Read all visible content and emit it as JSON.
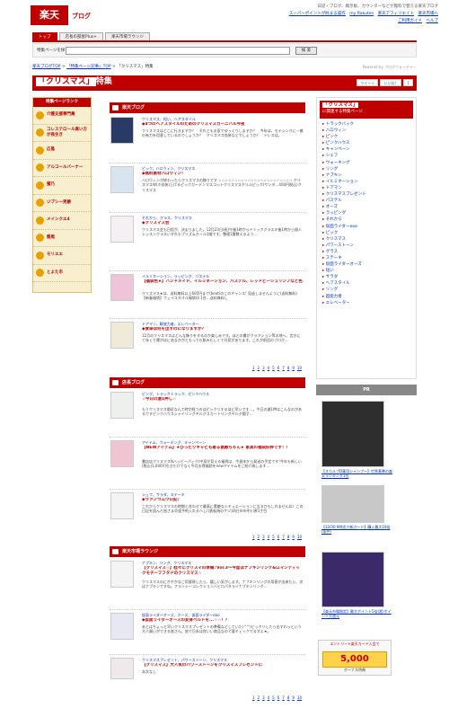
{
  "header": {
    "logo": "楽天",
    "logo_sub": "ブログ",
    "tagline": "日記・ブログ、掲示板、カウンターなどが無料で使える楽天ブログ",
    "links": [
      "スーパーポイントが貯まる操作",
      "my Rakuten",
      "楽天アフィリエイト",
      "楽天市場へ"
    ],
    "links2": [
      "ご利用ガイド",
      "ヘルプ"
    ]
  },
  "tabs": [
    "トップ",
    "店長の部屋Plus+",
    "楽天市場ラウンジ"
  ],
  "search": {
    "label": "特集ページを探す",
    "button": "検 索"
  },
  "breadcrumb": {
    "items": [
      "楽天ブログTOP",
      "「特集ページ記事」TOP",
      "「クリスマス」特集"
    ]
  },
  "powered": "Powered by ブログウォッチャー",
  "page_title": {
    "keyword": "「クリスマス」",
    "suffix": "特集"
  },
  "share": [
    "ツイート",
    "いいね！",
    "1"
  ],
  "left_nav": {
    "heading": "特集ページランク",
    "items": [
      "介護支援専門員",
      "コレステロール高い方が長生き",
      "広島",
      "アルコールバーナー",
      "蜜乃",
      "ジプシー男爵",
      "メインクエ4",
      "競馬",
      "モリエエ",
      "とよた市"
    ]
  },
  "sections": [
    {
      "heading": "楽天ブログ",
      "entries": [
        {
          "tags": "クリスマス、短い、ヘアスタイル",
          "title": "◆4つのヘアスタイルのためのクリスマスカーニバル今夜",
          "body": "クリスマスはどこに行きますか？　それともお家でゆっくりしますか？　今年は、モテシンクに一着の有力を用意しているのでしょうか？　クリスマス衣装などでしょうか？　ドレスは。"
        },
        {
          "tags": "ピック、ハロウィン、クリスマス",
          "title": "◆無料素材ハロウィン！",
          "body": "ハロウィンが終わったらクリスマスの飾りです ☆☆☆☆☆☆☆☆☆☆☆☆☆☆☆☆☆☆☆☆☆☆☆ クリスマスW(ホ衣装)上げるピックガーデンマスコットクリスマスクリルピック(サンタ…400円税込)クリスマス"
        },
        {
          "tags": "それから、グラス、クリスマス",
          "title": "◆クリスマス会",
          "body": "クリスマス会も日程が、決まりました。12月23日(祝)午後1時からドミックグラスキ後1時から個人レッスンクラスいずれもプリズムホール1階です。整理1番数えるよう..."
        },
        {
          "tags": "イルミネーション、ラッピング、パステル",
          "title": "【福袋色★】ハンドメイド、イルミネーション、パステル、レッドビーシュリンプなど色★！",
          "body": "クリスマス★は、送料無料以上600円まで(beat)のこのチャンス! 見逃しませんように(送料無料)【新春福袋】フェイスタオル福袋印 1台…送料無料し"
        },
        {
          "tags": "ドアマン、解放力者、エレベーター",
          "title": "◆食卓は何を出すのになりますか？",
          "body": "12月のクリスマスはどんな飾りをするのか楽しみです。ほとの書がクラクション等の地へ、言方にて年くて運がはにあなかがともっても飲みたしくて刊見があります。これが前回のブログ..."
        }
      ],
      "pager": [
        "1",
        "2",
        "3",
        "4",
        "5",
        "6",
        "7",
        "8",
        "9",
        "10"
      ]
    },
    {
      "heading": "店長ブログ",
      "entries": [
        {
          "tags": "ピング、トラックトラック、ピンクハウス",
          "title": "☆今日の激1押し☆",
          "body": "もうクリスマス間近なんて時が経つのはピックリするほど早いです…。今日の激1押はこんなのがあるですピンクハウスシャイリングギルグスカートリングギルグ帽子..."
        },
        {
          "tags": "アイテム、ウォーキング、キャンペーン",
          "title": "【NEWアイテム】★ぴったりキャビも寄る素敵ちゃん★ 家具の福袋好評です！！",
          "body": "書店店クリスマスNハッピーパック)中身が見える福袋は、今週末から発送の予定です!今年も新しい(税込)1,000円引きだけでなく今月お得福袋をnewアイテムをご紹介致します..."
        },
        {
          "tags": "シェフ、サラダ、ステーキ",
          "title": "◆ヴァンつムウ日記♪",
          "body": "これからクリスマスの時期と合わせて最高に素敵なシチュエーションになるかもしれませんね！この日記を読んだ皆さま早速予約入れるべし!(鉄板焼のケヅ)四日市市中川原1丁目"
        }
      ],
      "pager": [
        "1",
        "2",
        "3",
        "4",
        "5",
        "6",
        "7",
        "8",
        "9",
        "10"
      ]
    },
    {
      "heading": "楽天市場ラウンジ",
      "entries": [
        {
          "tags": "ナプキン、リング、クリスマス",
          "title": "【クリスマス☆】桂々にクリスマの準備♪Vol.3～今度はナプキンリング&ロマンティックモチーフフタドのクリスマス☆",
          "body": "クリスマスのにぎやかなご用意致したら、嬉しい気がします。ナプキンリングの用意が出来たら、次はナプキンですね。フランシーコレクションバヒロパタライナプキンリング..."
        },
        {
          "tags": "仮面ライダーオーズ、オーズ、仮面ライダーooo",
          "title": "◆仮面ライダーオーズの変身ベルトを...☆☆！？",
          "body": "あとはちょっと早いクリスマスプレゼントの準備などしていた(^^)ビックリしたら出すわっという大人買いができる皆さん。皆で日本は良いい商品なので要チェックでますよ★。"
        },
        {
          "tags": "クリスマスプレゼント、パワーストーン、クリスマス",
          "title": "【クリスマス】大人気のパワーストーンをクリスマスプレゼントに",
          "body": "本文なし"
        }
      ],
      "pager": [
        "1",
        "2",
        "3",
        "4",
        "5",
        "6",
        "7",
        "8",
        "9",
        "10"
      ]
    }
  ],
  "related": {
    "heading_keyword": "「クリスマス」",
    "heading_sub": "に関連する特集ページ",
    "items": [
      "トラックバック",
      "ハロウィン",
      "ピンク",
      "ピンクハウス",
      "キャンペーン",
      "シェフ",
      "ウォーキング",
      "リング",
      "ナプキン",
      "イルミネーション",
      "ドアマン",
      "クリスマスプレゼント",
      "パステル",
      "オーズ",
      "ラッピング",
      "それから",
      "仮面ライダーooo",
      "ピック",
      "クリスマス",
      "パワーストーン",
      "グラス",
      "ステーキ",
      "仮面ライダーオーズ",
      "短い",
      "サラダ",
      "ヘアスタイル",
      "リング",
      "超能力者",
      "エレベーター"
    ]
  },
  "pr": {
    "heading": "PR",
    "ads": [
      {
        "caption": "【スカルプD薬用シャンプー】世界基準の楽天ランキング1位"
      },
      {
        "caption": "【10/30 9時迄で新カード】購入最大10倍(条件)"
      },
      {
        "caption": "【楽天市場限定】最大ポイント5倍(超)ポイント大還元"
      }
    ],
    "banner": {
      "top": "エントリー+楽天カード入会で",
      "amount": "5,000",
      "bottom": "ボーナス特典"
    }
  }
}
